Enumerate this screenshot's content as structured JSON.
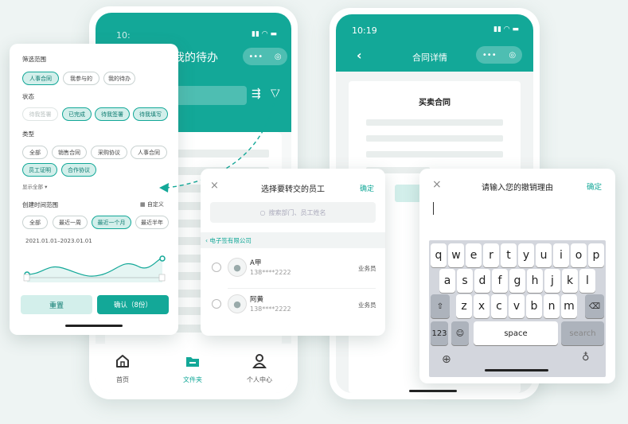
{
  "colors": {
    "accent": "#13a898",
    "accent_light": "#d3efeb",
    "background": "#eef4f3"
  },
  "phone1": {
    "time": "10:",
    "title": "我的待办",
    "tabbar": [
      {
        "label": "首页",
        "icon": "home-icon"
      },
      {
        "label": "文件夹",
        "icon": "folder-icon"
      },
      {
        "label": "个人中心",
        "icon": "user-icon"
      }
    ]
  },
  "phone2": {
    "time": "10:19",
    "title": "合同详情",
    "doc_title": "买卖合同"
  },
  "filter": {
    "scope_title": "筛选范围",
    "scope_options": [
      "人事合同",
      "我参与的",
      "我的待办"
    ],
    "status_title": "状态",
    "status_options": [
      "待我签署",
      "已完成",
      "待我签署",
      "待我填写"
    ],
    "type_title": "类型",
    "type_options": [
      "全部",
      "销售合同",
      "采购协议",
      "人事合同",
      "员工证明",
      "合作协议"
    ],
    "show_all": "显示全部",
    "time_title": "创建时间范围",
    "custom": "自定义",
    "time_options": [
      "全部",
      "最近一周",
      "最近一个月",
      "最近半年"
    ],
    "date_range": "2021.01.01–2023.01.01",
    "reset": "重置",
    "confirm": "确认（8份）"
  },
  "transfer": {
    "close": "×",
    "title": "选择要转交的员工",
    "confirm": "确定",
    "search_placeholder": "搜索部门、员工姓名",
    "company": "电子签有限公司",
    "employees": [
      {
        "name": "A甲",
        "phone": "138****2222",
        "role": "业务员"
      },
      {
        "name": "阿黄",
        "phone": "138****2222",
        "role": "业务员"
      }
    ]
  },
  "revoke": {
    "close": "×",
    "title": "请输入您的撤销理由",
    "confirm": "确定",
    "keyboard": {
      "row1": [
        "q",
        "w",
        "e",
        "r",
        "t",
        "y",
        "u",
        "i",
        "o",
        "p"
      ],
      "row2": [
        "a",
        "s",
        "d",
        "f",
        "g",
        "h",
        "j",
        "k",
        "l"
      ],
      "row3": [
        "z",
        "x",
        "c",
        "v",
        "b",
        "n",
        "m"
      ],
      "num": "123",
      "space": "space",
      "search": "search"
    }
  }
}
